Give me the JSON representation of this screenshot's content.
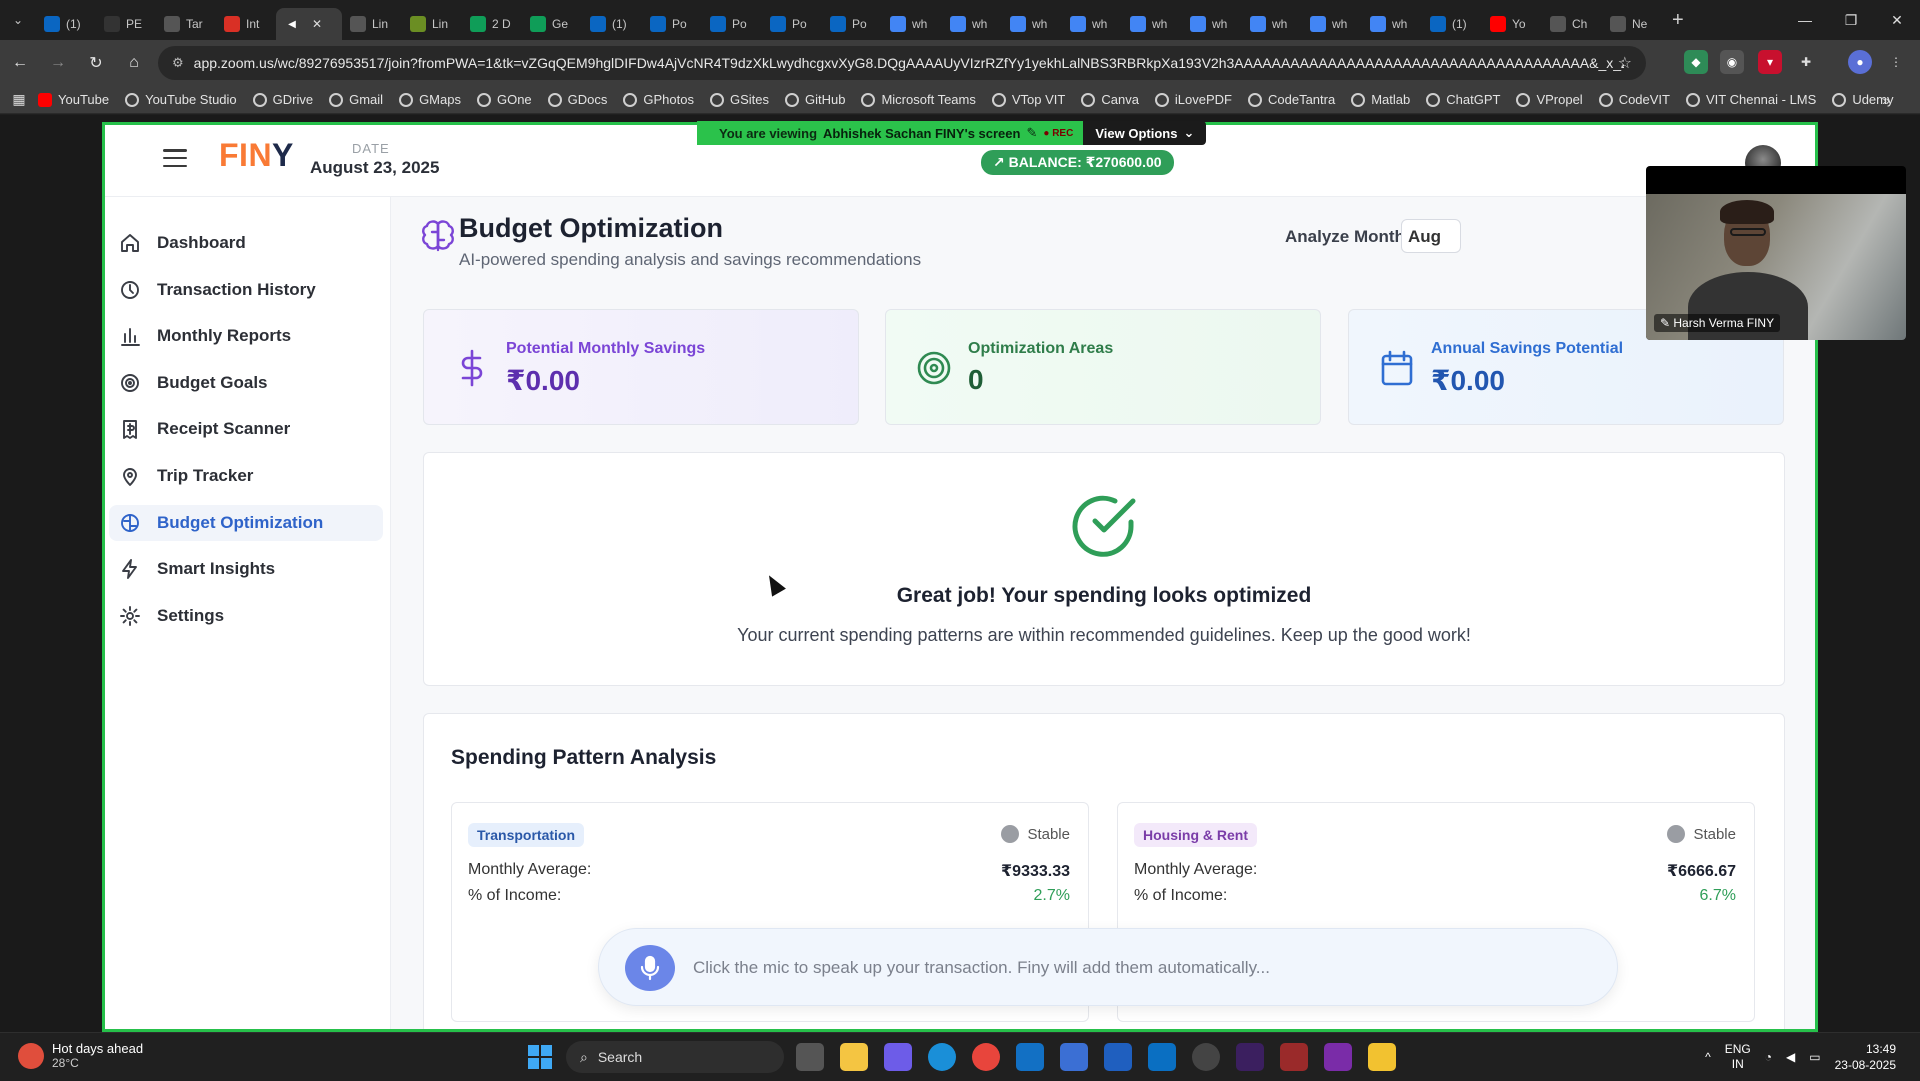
{
  "browser": {
    "tabs": [
      {
        "label": "(1)",
        "icon": "linkedin",
        "color": "#0a66c2"
      },
      {
        "label": "PE",
        "icon": "github",
        "color": "#333333"
      },
      {
        "label": "Tar",
        "icon": "globe",
        "color": "#555555"
      },
      {
        "label": "Int",
        "icon": "gmail",
        "color": "#d93025"
      },
      {
        "label": "",
        "icon": "zoom-audio",
        "color": "#3c3c3c",
        "active": true
      },
      {
        "label": "Lin",
        "icon": "globe",
        "color": "#555555"
      },
      {
        "label": "Lin",
        "icon": "dots",
        "color": "#6b8e23"
      },
      {
        "label": "2 D",
        "icon": "sheets",
        "color": "#0f9d58"
      },
      {
        "label": "Ge",
        "icon": "sheets",
        "color": "#0f9d58"
      },
      {
        "label": "(1)",
        "icon": "linkedin",
        "color": "#0a66c2"
      },
      {
        "label": "Po",
        "icon": "linkedin",
        "color": "#0a66c2"
      },
      {
        "label": "Po",
        "icon": "linkedin",
        "color": "#0a66c2"
      },
      {
        "label": "Po",
        "icon": "linkedin",
        "color": "#0a66c2"
      },
      {
        "label": "Po",
        "icon": "linkedin",
        "color": "#0a66c2"
      },
      {
        "label": "wh",
        "icon": "google",
        "color": "#4285f4"
      },
      {
        "label": "wh",
        "icon": "google",
        "color": "#4285f4"
      },
      {
        "label": "wh",
        "icon": "google",
        "color": "#4285f4"
      },
      {
        "label": "wh",
        "icon": "google",
        "color": "#4285f4"
      },
      {
        "label": "wh",
        "icon": "google",
        "color": "#4285f4"
      },
      {
        "label": "wh",
        "icon": "google",
        "color": "#4285f4"
      },
      {
        "label": "wh",
        "icon": "google",
        "color": "#4285f4"
      },
      {
        "label": "wh",
        "icon": "google",
        "color": "#4285f4"
      },
      {
        "label": "wh",
        "icon": "google",
        "color": "#4285f4"
      },
      {
        "label": "(1)",
        "icon": "linkedin",
        "color": "#0a66c2"
      },
      {
        "label": "Yo",
        "icon": "youtube",
        "color": "#ff0000"
      },
      {
        "label": "Ch",
        "icon": "chatgpt",
        "color": "#555555"
      },
      {
        "label": "Ne",
        "icon": "chatgpt",
        "color": "#555555"
      }
    ],
    "url": "app.zoom.us/wc/89276953517/join?fromPWA=1&tk=vZGqQEM9hglDIFDw4AjVcNR4T9dzXkLwydhcgxvXyG8.DQgAAAAUyVIzrRZfYy1yekhLalNBS3RBRkpXa193V2h3AAAAAAAAAAAAAAAAAAAAAAAAAAAAAAAAAAAAAA&_x_zm_r...",
    "bookmarks": [
      "YouTube",
      "YouTube Studio",
      "GDrive",
      "Gmail",
      "GMaps",
      "GOne",
      "GDocs",
      "GPhotos",
      "GSites",
      "GitHub",
      "Microsoft Teams",
      "VTop VIT",
      "Canva",
      "iLovePDF",
      "CodeTantra",
      "Matlab",
      "ChatGPT",
      "VPropel",
      "CodeVIT",
      "VIT Chennai - LMS",
      "Udemy"
    ]
  },
  "zoom": {
    "viewing_prefix": "You are viewing",
    "presenter": "Abhishek Sachan FINY's screen",
    "rec": "REC",
    "view_options": "View Options",
    "participant_name": "Harsh Verma FINY"
  },
  "app": {
    "logo_fin": "FIN",
    "logo_y": "Y",
    "date_label": "DATE",
    "date_value": "August 23, 2025",
    "balance": "BALANCE: ₹270600.00",
    "nav": [
      {
        "label": "Dashboard",
        "icon": "home-icon"
      },
      {
        "label": "Transaction History",
        "icon": "clock-icon"
      },
      {
        "label": "Monthly Reports",
        "icon": "bar-chart-icon"
      },
      {
        "label": "Budget Goals",
        "icon": "target-icon"
      },
      {
        "label": "Receipt Scanner",
        "icon": "receipt-icon"
      },
      {
        "label": "Trip Tracker",
        "icon": "map-pin-icon"
      },
      {
        "label": "Budget Optimization",
        "icon": "brain-icon",
        "active": true
      },
      {
        "label": "Smart Insights",
        "icon": "bolt-icon"
      },
      {
        "label": "Settings",
        "icon": "gear-icon"
      }
    ],
    "page": {
      "title": "Budget Optimization",
      "subtitle": "AI-powered spending analysis and savings recommendations",
      "analyze_label": "Analyze Month:",
      "month_value": "Aug"
    },
    "stats": [
      {
        "label": "Potential Monthly Savings",
        "value": "₹0.00"
      },
      {
        "label": "Optimization Areas",
        "value": "0"
      },
      {
        "label": "Annual Savings Potential",
        "value": "₹0.00"
      }
    ],
    "optimized": {
      "heading": "Great job! Your spending looks optimized",
      "text": "Your current spending patterns are within recommended guidelines. Keep up the good work!"
    },
    "analysis": {
      "title": "Spending Pattern Analysis",
      "categories": [
        {
          "name": "Transportation",
          "trend": "Stable",
          "avg_label": "Monthly Average:",
          "avg_value": "₹9333.33",
          "pct_label": "% of Income:",
          "pct_value": "2.7%"
        },
        {
          "name": "Housing & Rent",
          "trend": "Stable",
          "avg_label": "Monthly Average:",
          "avg_value": "₹6666.67",
          "pct_label": "% of Income:",
          "pct_value": "6.7%"
        }
      ]
    },
    "mic_prompt": "Click the mic to speak up your transaction. Finy will add them automatically..."
  },
  "taskbar": {
    "weather_title": "Hot days ahead",
    "weather_temp": "28°C",
    "search": "Search",
    "lang_1": "ENG",
    "lang_2": "IN",
    "time": "13:49",
    "date": "23-08-2025"
  },
  "colors": {
    "accent": "#2f63c9",
    "share_border": "#26c04a",
    "balance_bg": "#2f9e58",
    "logo_orange": "#f97a35"
  }
}
